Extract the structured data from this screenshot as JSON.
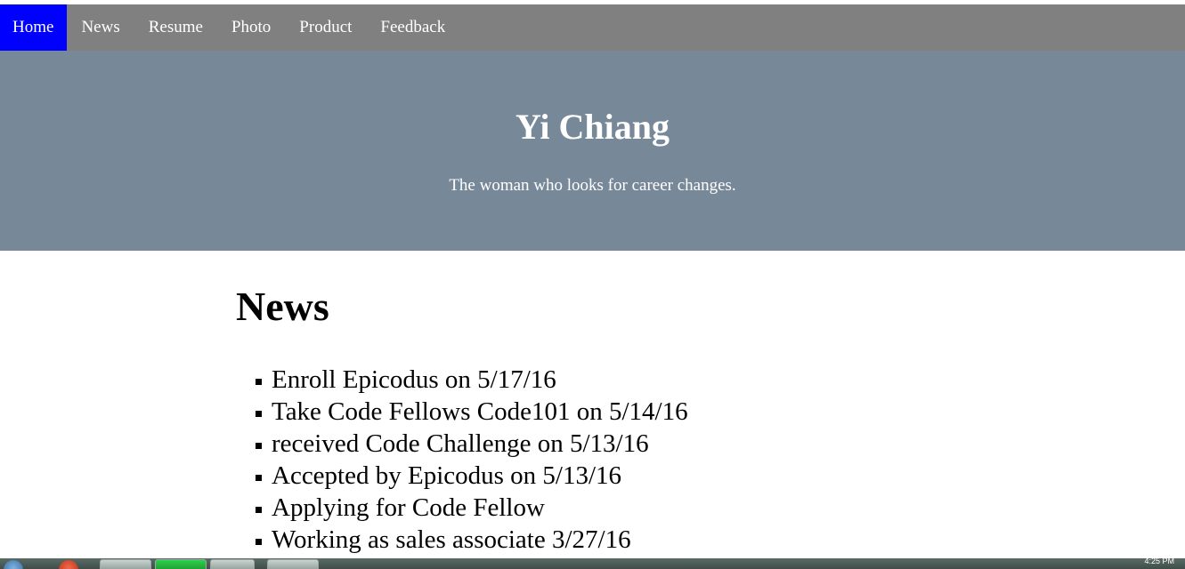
{
  "nav": {
    "items": [
      {
        "label": "Home",
        "active": true
      },
      {
        "label": "News",
        "active": false
      },
      {
        "label": "Resume",
        "active": false
      },
      {
        "label": "Photo",
        "active": false
      },
      {
        "label": "Product",
        "active": false
      },
      {
        "label": "Feedback",
        "active": false
      }
    ]
  },
  "hero": {
    "title": "Yi Chiang",
    "subtitle": "The woman who looks for career changes."
  },
  "news": {
    "heading": "News",
    "items": [
      "Enroll Epicodus on 5/17/16",
      "Take Code Fellows Code101 on 5/14/16",
      "received Code Challenge on 5/13/16",
      "Accepted by Epicodus on 5/13/16",
      "Applying for Code Fellow",
      "Working as sales associate 3/27/16"
    ]
  },
  "taskbar": {
    "clock": "4:25 PM"
  },
  "colors": {
    "nav_bg": "#808080",
    "nav_active": "#0000ff",
    "hero_bg": "#778899",
    "text_light": "#ffffff",
    "text_dark": "#000000"
  }
}
